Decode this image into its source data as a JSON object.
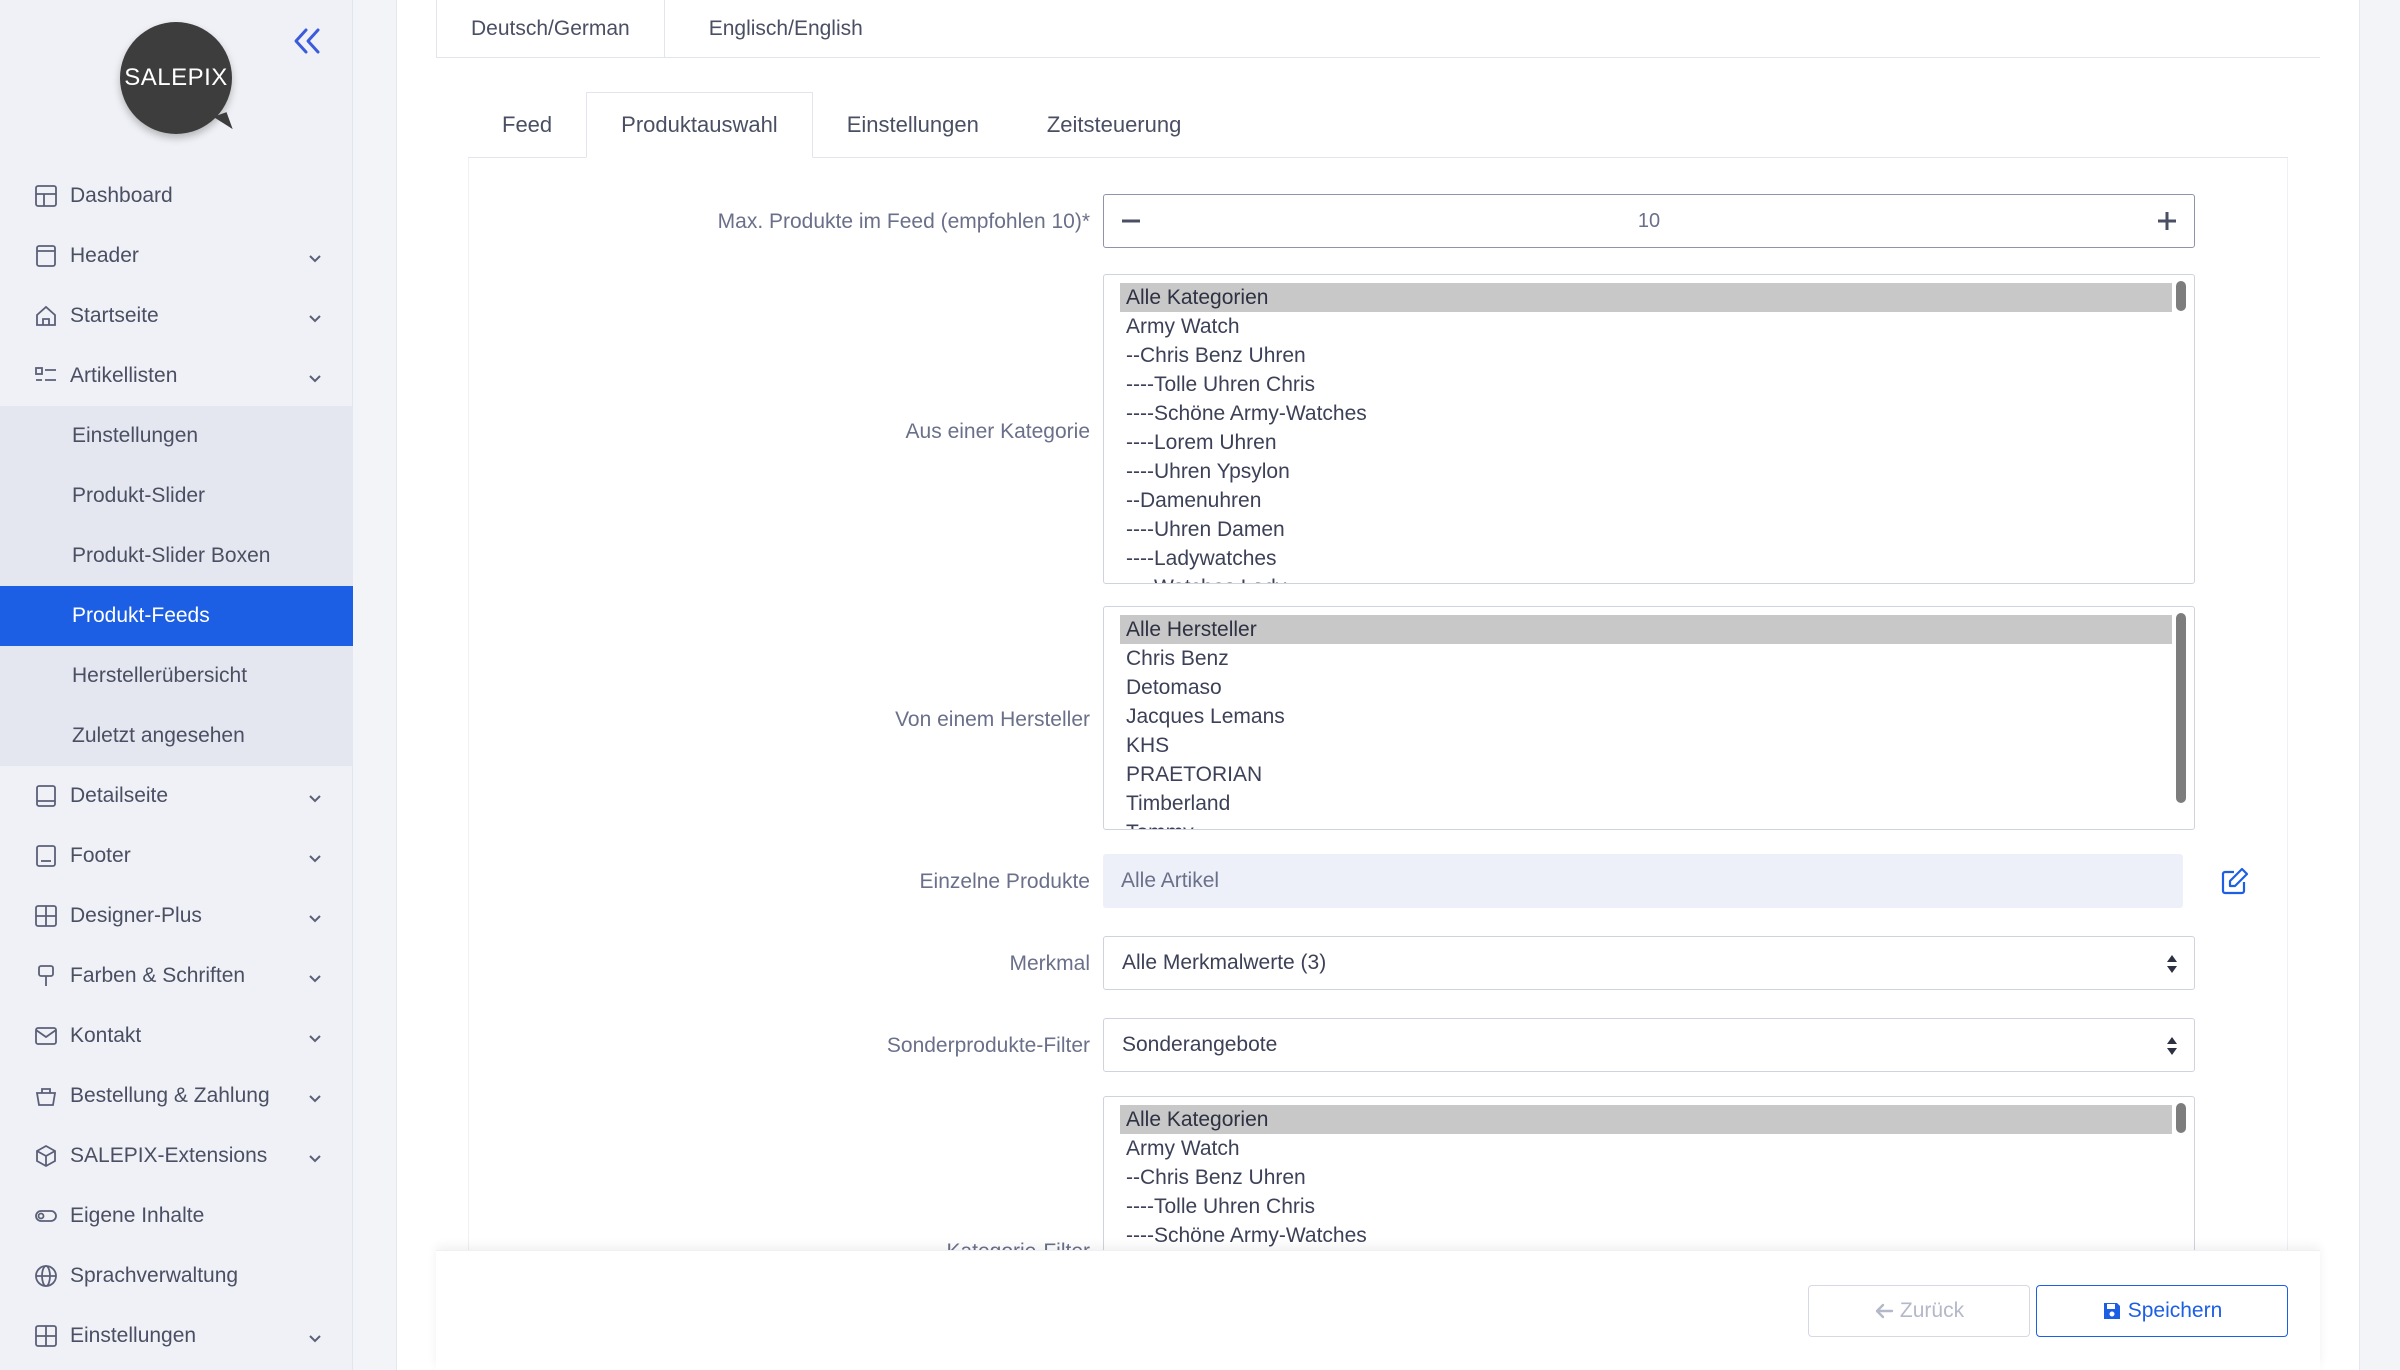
{
  "brand": {
    "logo_text": "SALEPIX"
  },
  "colors": {
    "accent": "#1d5fe4",
    "sidebar_bg": "#eff1f6",
    "active_bg": "#1d5fe4"
  },
  "sidebar": {
    "items": [
      {
        "label": "Dashboard",
        "icon": "dashboard-icon"
      },
      {
        "label": "Header",
        "icon": "header-icon",
        "has_chevron": true
      },
      {
        "label": "Startseite",
        "icon": "home-icon",
        "has_chevron": true
      },
      {
        "label": "Artikellisten",
        "icon": "list-icon",
        "has_chevron": true,
        "expanded": true
      }
    ],
    "subitems": [
      {
        "label": "Einstellungen"
      },
      {
        "label": "Produkt-Slider"
      },
      {
        "label": "Produkt-Slider Boxen"
      },
      {
        "label": "Produkt-Feeds",
        "active": true
      },
      {
        "label": "Herstellerübersicht"
      },
      {
        "label": "Zuletzt angesehen"
      }
    ],
    "items_after": [
      {
        "label": "Detailseite",
        "icon": "detail-page-icon"
      },
      {
        "label": "Footer",
        "icon": "footer-icon"
      },
      {
        "label": "Designer-Plus",
        "icon": "grid-icon"
      },
      {
        "label": "Farben & Schriften",
        "icon": "brush-icon"
      },
      {
        "label": "Kontakt",
        "icon": "mail-icon"
      },
      {
        "label": "Bestellung & Zahlung",
        "icon": "basket-icon"
      },
      {
        "label": "SALEPIX-Extensions",
        "icon": "package-icon"
      },
      {
        "label": "Eigene Inhalte",
        "icon": "toggle-icon"
      },
      {
        "label": "Sprachverwaltung",
        "icon": "globe-icon"
      },
      {
        "label": "Einstellungen",
        "icon": "settings-grid-icon"
      }
    ]
  },
  "language_tabs": [
    "Deutsch/German",
    "Englisch/English"
  ],
  "sub_tabs": [
    {
      "label": "Feed"
    },
    {
      "label": "Produktauswahl",
      "active": true
    },
    {
      "label": "Einstellungen"
    },
    {
      "label": "Zeitsteuerung"
    }
  ],
  "form": {
    "max_products": {
      "label": "Max. Produkte im Feed (empfohlen 10)*",
      "value": "10"
    },
    "category": {
      "label": "Aus einer Kategorie",
      "options": [
        "Alle Kategorien",
        "Army Watch",
        "--Chris Benz Uhren",
        "----Tolle Uhren Chris",
        "----Schöne Army-Watches",
        "----Lorem Uhren",
        "----Uhren Ypsylon",
        "--Damenuhren",
        "----Uhren Damen",
        "----Ladywatches",
        "----Watches Lady"
      ]
    },
    "manufacturer": {
      "label": "Von einem Hersteller",
      "options": [
        "Alle Hersteller",
        "Chris Benz",
        "Detomaso",
        "Jacques Lemans",
        "KHS",
        "PRAETORIAN",
        "Timberland",
        "Tommy"
      ]
    },
    "single_products": {
      "label": "Einzelne Produkte",
      "value": "Alle Artikel"
    },
    "feature": {
      "label": "Merkmal",
      "value": "Alle Merkmalwerte (3)"
    },
    "special_filter": {
      "label": "Sonderprodukte-Filter",
      "value": "Sonderangebote"
    },
    "category_filter": {
      "label": "Kategorie-Filter",
      "options": [
        "Alle Kategorien",
        "Army Watch",
        "--Chris Benz Uhren",
        "----Tolle Uhren Chris",
        "----Schöne Army-Watches"
      ]
    }
  },
  "footer": {
    "back_label": "Zurück",
    "save_label": "Speichern"
  }
}
